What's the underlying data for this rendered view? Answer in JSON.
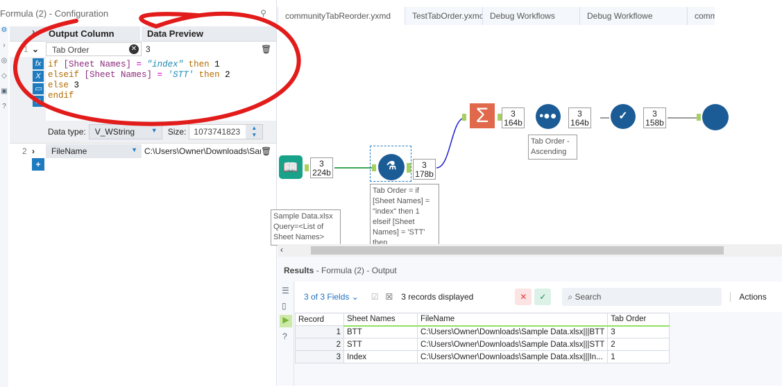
{
  "config": {
    "title": "Formula (2) - Configuration",
    "headers": {
      "output_column": "Output Column",
      "data_preview": "Data Preview"
    },
    "rows": [
      {
        "num": "1",
        "column": "Tab Order",
        "preview": "3"
      },
      {
        "num": "2",
        "column": "FileName",
        "preview": "C:\\Users\\Owner\\Downloads\\Sam"
      }
    ],
    "expression": [
      [
        [
          "kw",
          "if "
        ],
        [
          "fld",
          "[Sheet Names]"
        ],
        [
          "op",
          " = "
        ],
        [
          "str",
          "\"index\""
        ],
        [
          "kw",
          " then "
        ],
        [
          "num",
          "1"
        ]
      ],
      [
        [
          "kw",
          "elseif "
        ],
        [
          "fld",
          "[Sheet Names]"
        ],
        [
          "op",
          " = "
        ],
        [
          "str",
          "'STT'"
        ],
        [
          "kw",
          " then "
        ],
        [
          "num",
          "2"
        ]
      ],
      [
        [
          "kw",
          "else "
        ],
        [
          "num",
          "3"
        ]
      ],
      [
        [
          "kw",
          "endif"
        ]
      ]
    ],
    "expr_icons": [
      "fx",
      "X",
      "folder",
      "save"
    ],
    "data_type_label": "Data type:",
    "data_type": "V_WString",
    "size_label": "Size:",
    "size": "1073741823",
    "add": "+"
  },
  "tabs": [
    "communityTabReorder.yxmd",
    "TestTabOrder.yxmc",
    "Debug Workflows",
    "Debug Workflowe",
    "commi"
  ],
  "canvas": {
    "badges": [
      {
        "count": "3",
        "size": "224b"
      },
      {
        "count": "3",
        "size": "178b"
      },
      {
        "count": "3",
        "size": "164b"
      },
      {
        "count": "3",
        "size": "164b"
      },
      {
        "count": "3",
        "size": "158b"
      }
    ],
    "annotations": {
      "input": "Sample Data.xlsx Query=<List of Sheet Names>",
      "formula": "Tab Order = if [Sheet Names] = \"index\" then 1 elseif [Sheet Names] = 'STT' then",
      "sort": "Tab Order - Ascending"
    }
  },
  "results": {
    "title": "Results",
    "subtitle": " - Formula (2) - Output",
    "fields": "3 of 3 Fields",
    "records": "3 records displayed",
    "search_placeholder": "Search",
    "actions": "Actions",
    "columns": [
      "Record",
      "Sheet Names",
      "FileName",
      "Tab Order"
    ],
    "rows": [
      [
        "1",
        "BTT",
        "C:\\Users\\Owner\\Downloads\\Sample Data.xlsx|||BTT",
        "3"
      ],
      [
        "2",
        "STT",
        "C:\\Users\\Owner\\Downloads\\Sample Data.xlsx|||STT",
        "2"
      ],
      [
        "3",
        "Index",
        "C:\\Users\\Owner\\Downloads\\Sample Data.xlsx|||In...",
        "1"
      ]
    ]
  },
  "colors": {
    "annotation": "#e21b1b",
    "node": "#1b5c96",
    "summarize": "#e0684b"
  }
}
